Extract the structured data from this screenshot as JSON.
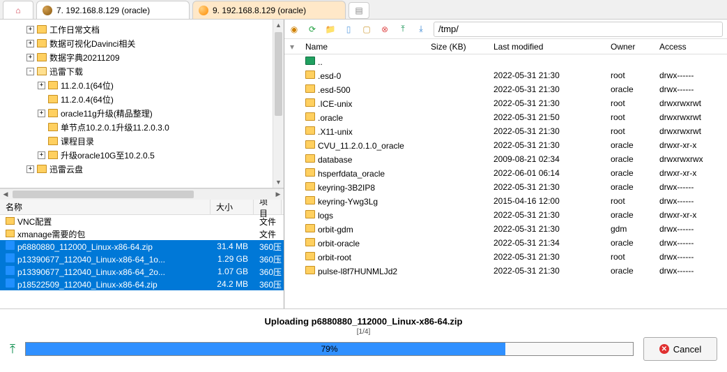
{
  "tabs": {
    "tab1_label": "7. 192.168.8.129 (oracle)",
    "tab2_label": "9. 192.168.8.129 (oracle)"
  },
  "tree": [
    {
      "indent": 2,
      "toggle": "+",
      "label": "工作日常文档"
    },
    {
      "indent": 2,
      "toggle": "+",
      "label": "数据可视化Davinci相关"
    },
    {
      "indent": 2,
      "toggle": "+",
      "label": "数据字典20211209"
    },
    {
      "indent": 2,
      "toggle": "-",
      "label": "迅雷下载",
      "open": true
    },
    {
      "indent": 3,
      "toggle": "+",
      "label": "11.2.0.1(64位)"
    },
    {
      "indent": 3,
      "toggle": "",
      "label": "11.2.0.4(64位)"
    },
    {
      "indent": 3,
      "toggle": "+",
      "label": "oracle11g升级(精品整理)"
    },
    {
      "indent": 3,
      "toggle": "",
      "label": "单节点10.2.0.1升级11.2.0.3.0"
    },
    {
      "indent": 3,
      "toggle": "",
      "label": "课程目录"
    },
    {
      "indent": 3,
      "toggle": "+",
      "label": "升级oracle10G至10.2.0.5"
    },
    {
      "indent": 2,
      "toggle": "+",
      "label": "迅雷云盘"
    }
  ],
  "local_cols": {
    "name": "名称",
    "size": "大小",
    "type": "项目"
  },
  "local_files": [
    {
      "icon": "folder",
      "name": "VNC配置",
      "size": "",
      "type": "文件",
      "sel": false
    },
    {
      "icon": "folder",
      "name": "xmanage需要的包",
      "size": "",
      "type": "文件",
      "sel": false
    },
    {
      "icon": "zip",
      "name": "p6880880_112000_Linux-x86-64.zip",
      "size": "31.4 MB",
      "type": "360压",
      "sel": true
    },
    {
      "icon": "zip",
      "name": "p13390677_112040_Linux-x86-64_1o...",
      "size": "1.29 GB",
      "type": "360压",
      "sel": true
    },
    {
      "icon": "zip",
      "name": "p13390677_112040_Linux-x86-64_2o...",
      "size": "1.07 GB",
      "type": "360压",
      "sel": true
    },
    {
      "icon": "zip",
      "name": "p18522509_112040_Linux-x86-64.zip",
      "size": "24.2 MB",
      "type": "360压",
      "sel": true
    }
  ],
  "remote_path": "/tmp/",
  "remote_cols": {
    "name": "Name",
    "size": "Size (KB)",
    "mod": "Last modified",
    "owner": "Owner",
    "access": "Access"
  },
  "remote_files": [
    {
      "up": true,
      "name": ".."
    },
    {
      "name": ".esd-0",
      "mod": "2022-05-31 21:30",
      "owner": "root",
      "access": "drwx------"
    },
    {
      "name": ".esd-500",
      "mod": "2022-05-31 21:30",
      "owner": "oracle",
      "access": "drwx------"
    },
    {
      "name": ".ICE-unix",
      "mod": "2022-05-31 21:30",
      "owner": "root",
      "access": "drwxrwxrwt"
    },
    {
      "name": ".oracle",
      "mod": "2022-05-31 21:50",
      "owner": "root",
      "access": "drwxrwxrwt"
    },
    {
      "name": ".X11-unix",
      "mod": "2022-05-31 21:30",
      "owner": "root",
      "access": "drwxrwxrwt"
    },
    {
      "name": "CVU_11.2.0.1.0_oracle",
      "mod": "2022-05-31 21:30",
      "owner": "oracle",
      "access": "drwxr-xr-x"
    },
    {
      "name": "database",
      "mod": "2009-08-21 02:34",
      "owner": "oracle",
      "access": "drwxrwxrwx"
    },
    {
      "name": "hsperfdata_oracle",
      "mod": "2022-06-01 06:14",
      "owner": "oracle",
      "access": "drwxr-xr-x"
    },
    {
      "name": "keyring-3B2IP8",
      "mod": "2022-05-31 21:30",
      "owner": "oracle",
      "access": "drwx------"
    },
    {
      "name": "keyring-Ywg3Lg",
      "mod": "2015-04-16 12:00",
      "owner": "root",
      "access": "drwx------"
    },
    {
      "name": "logs",
      "mod": "2022-05-31 21:30",
      "owner": "oracle",
      "access": "drwxr-xr-x"
    },
    {
      "name": "orbit-gdm",
      "mod": "2022-05-31 21:30",
      "owner": "gdm",
      "access": "drwx------"
    },
    {
      "name": "orbit-oracle",
      "mod": "2022-05-31 21:34",
      "owner": "oracle",
      "access": "drwx------"
    },
    {
      "name": "orbit-root",
      "mod": "2022-05-31 21:30",
      "owner": "root",
      "access": "drwx------"
    },
    {
      "name": "pulse-l8f7HUNMLJd2",
      "mod": "2022-05-31 21:30",
      "owner": "oracle",
      "access": "drwx------"
    }
  ],
  "transfer": {
    "title": "Uploading p6880880_112000_Linux-x86-64.zip",
    "count": "[1/4]",
    "percent": "79%",
    "percent_num": 79,
    "cancel": "Cancel"
  }
}
